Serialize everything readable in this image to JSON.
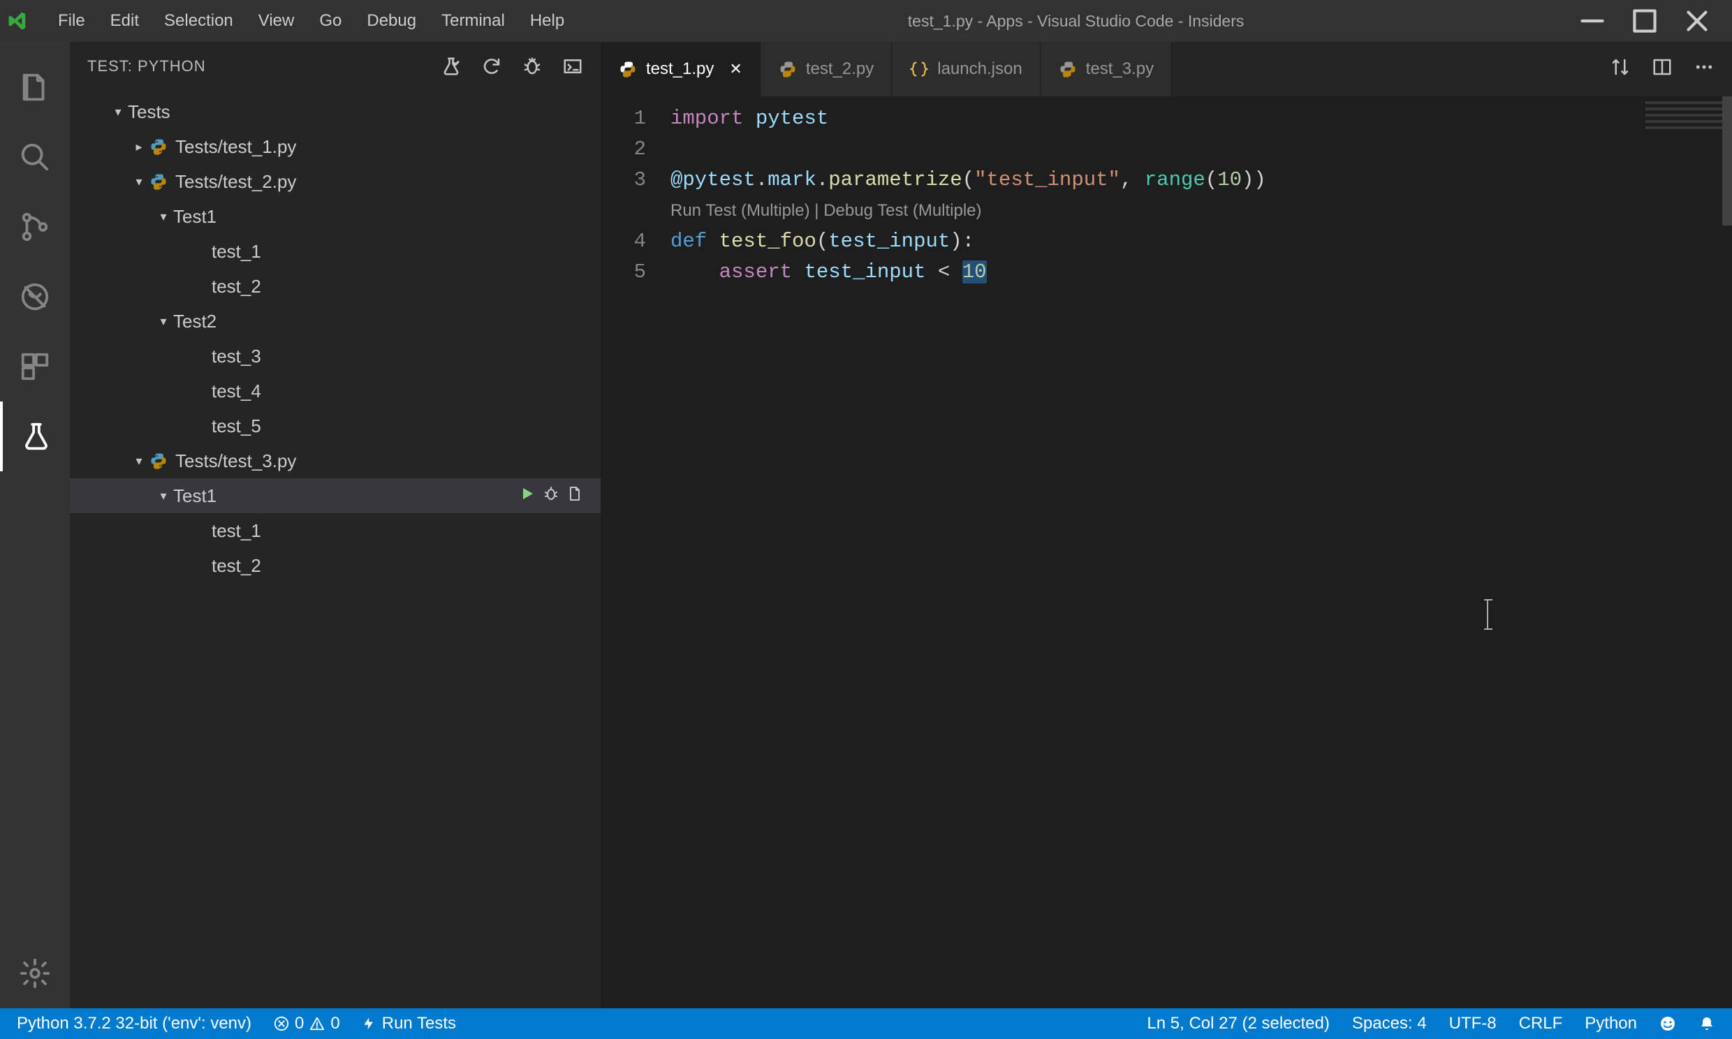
{
  "window": {
    "title": "test_1.py - Apps - Visual Studio Code - Insiders"
  },
  "menubar": [
    "File",
    "Edit",
    "Selection",
    "View",
    "Go",
    "Debug",
    "Terminal",
    "Help"
  ],
  "sidebar": {
    "title": "TEST: PYTHON",
    "tree": {
      "root": "Tests",
      "files": [
        {
          "name": "Tests/test_1.py",
          "expanded": false
        },
        {
          "name": "Tests/test_2.py",
          "expanded": true,
          "suites": [
            {
              "name": "Test1",
              "expanded": true,
              "tests": [
                "test_1",
                "test_2"
              ]
            },
            {
              "name": "Test2",
              "expanded": true,
              "tests": [
                "test_3",
                "test_4",
                "test_5"
              ]
            }
          ]
        },
        {
          "name": "Tests/test_3.py",
          "expanded": true,
          "suites": [
            {
              "name": "Test1",
              "expanded": true,
              "selected": true,
              "tests": [
                "test_1",
                "test_2"
              ]
            }
          ]
        }
      ]
    }
  },
  "tabs": [
    {
      "label": "test_1.py",
      "icon": "python",
      "active": true,
      "dirty": false
    },
    {
      "label": "test_2.py",
      "icon": "python",
      "active": false
    },
    {
      "label": "launch.json",
      "icon": "json",
      "active": false
    },
    {
      "label": "test_3.py",
      "icon": "python",
      "active": false
    }
  ],
  "editor": {
    "lines": [
      1,
      2,
      3,
      4,
      5
    ],
    "codelens": "Run Test (Multiple) | Debug Test (Multiple)",
    "code": {
      "l1_import": "import",
      "l1_module": "pytest",
      "l3_decorator_pkg": "@pytest",
      "l3_decorator_attr": "mark",
      "l3_decorator_fn": "parametrize",
      "l3_str": "\"test_input\"",
      "l3_builtin": "range",
      "l3_num": "10",
      "l4_def": "def",
      "l4_fn": "test_foo",
      "l4_param": "test_input",
      "l5_assert": "assert",
      "l5_var": "test_input",
      "l5_op": "<",
      "l5_num": "10"
    }
  },
  "statusbar": {
    "python": "Python 3.7.2 32-bit ('env': venv)",
    "errors": "0",
    "warnings": "0",
    "runtests": "Run Tests",
    "cursor": "Ln 5, Col 27 (2 selected)",
    "spaces": "Spaces: 4",
    "encoding": "UTF-8",
    "eol": "CRLF",
    "lang": "Python"
  }
}
